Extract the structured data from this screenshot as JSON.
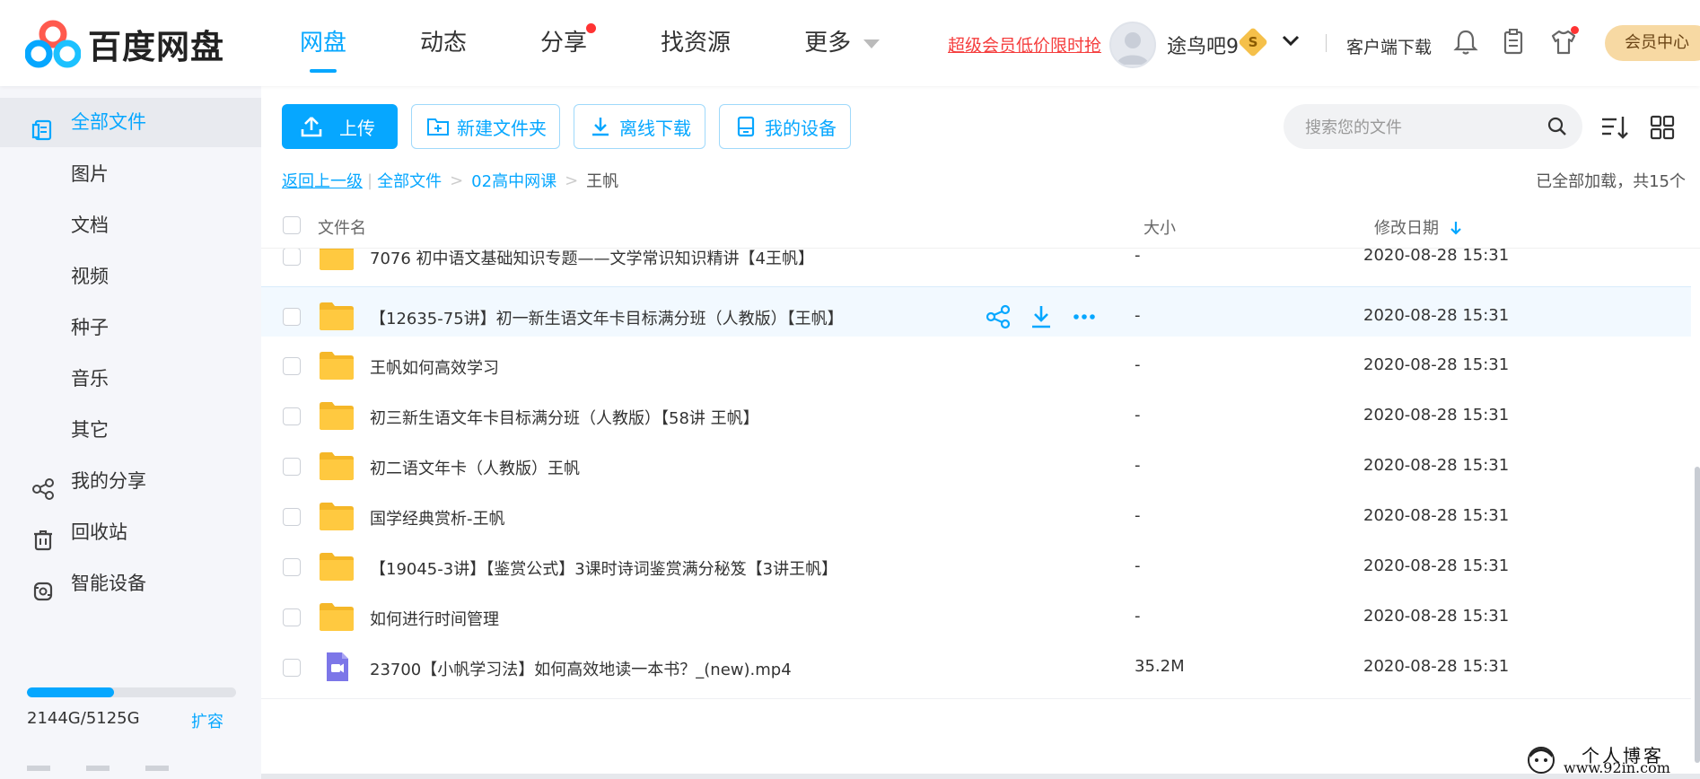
{
  "logo": {
    "text": "百度网盘"
  },
  "nav": {
    "items": [
      {
        "label": "网盘",
        "active": true
      },
      {
        "label": "动态"
      },
      {
        "label": "分享",
        "has_dot": true
      },
      {
        "label": "找资源"
      },
      {
        "label": "更多",
        "has_caret": true
      }
    ]
  },
  "header": {
    "promo": "超级会员低价限时抢",
    "username": "途鸟吧9",
    "vip_badge": "S",
    "client_download": "客户端下载",
    "vip_center": "会员中心",
    "icons": [
      "bell-icon",
      "clipboard-icon",
      "shirt-icon"
    ]
  },
  "sidebar": {
    "items": [
      {
        "label": "全部文件",
        "icon": "all-files-icon",
        "active": true
      },
      {
        "label": "图片"
      },
      {
        "label": "文档"
      },
      {
        "label": "视频"
      },
      {
        "label": "种子"
      },
      {
        "label": "音乐"
      },
      {
        "label": "其它"
      },
      {
        "label": "我的分享",
        "icon": "share-icon"
      },
      {
        "label": "回收站",
        "icon": "trash-icon"
      },
      {
        "label": "智能设备",
        "icon": "device-icon"
      }
    ],
    "quota": {
      "text": "2144G/5125G",
      "used_fraction": 0.418,
      "expand": "扩容"
    }
  },
  "toolbar": {
    "upload": "上传",
    "new_folder": "新建文件夹",
    "offline_download": "离线下载",
    "my_devices": "我的设备",
    "search_placeholder": "搜索您的文件"
  },
  "breadcrumb": {
    "back": "返回上一级",
    "root": "全部文件",
    "level1": "02高中网课",
    "current": "王帆"
  },
  "status": {
    "loaded": "已全部加载，共15个"
  },
  "columns": {
    "name": "文件名",
    "size": "大小",
    "modified": "修改日期"
  },
  "files": [
    {
      "name": "7076 初中语文基础知识专题——文学常识知识精讲【4王帆】",
      "size": "-",
      "date": "2020-08-28 15:31",
      "type": "folder"
    },
    {
      "name": "【12635-75讲】初一新生语文年卡目标满分班（人教版）【王帆】",
      "size": "-",
      "date": "2020-08-28 15:31",
      "type": "folder",
      "hover": true
    },
    {
      "name": "王帆如何高效学习",
      "size": "-",
      "date": "2020-08-28 15:31",
      "type": "folder"
    },
    {
      "name": "初三新生语文年卡目标满分班（人教版）【58讲 王帆】",
      "size": "-",
      "date": "2020-08-28 15:31",
      "type": "folder"
    },
    {
      "name": "初二语文年卡（人教版）王帆",
      "size": "-",
      "date": "2020-08-28 15:31",
      "type": "folder"
    },
    {
      "name": "国学经典赏析-王帆",
      "size": "-",
      "date": "2020-08-28 15:31",
      "type": "folder"
    },
    {
      "name": "【19045-3讲】【鉴赏公式】3课时诗词鉴赏满分秘笈【3讲王帆】",
      "size": "-",
      "date": "2020-08-28 15:31",
      "type": "folder"
    },
    {
      "name": "如何进行时间管理",
      "size": "-",
      "date": "2020-08-28 15:31",
      "type": "folder"
    },
    {
      "name": "23700【小帆学习法】如何高效地读一本书？_(new).mp4",
      "size": "35.2M",
      "date": "2020-08-28 15:31",
      "type": "video"
    }
  ],
  "watermark": {
    "title": "个人博客",
    "url": "www.92in.com"
  },
  "colors": {
    "accent": "#06a7ff",
    "folder": "#ffc940",
    "promo": "#f53d3d",
    "vip": "#f7d9a3"
  }
}
